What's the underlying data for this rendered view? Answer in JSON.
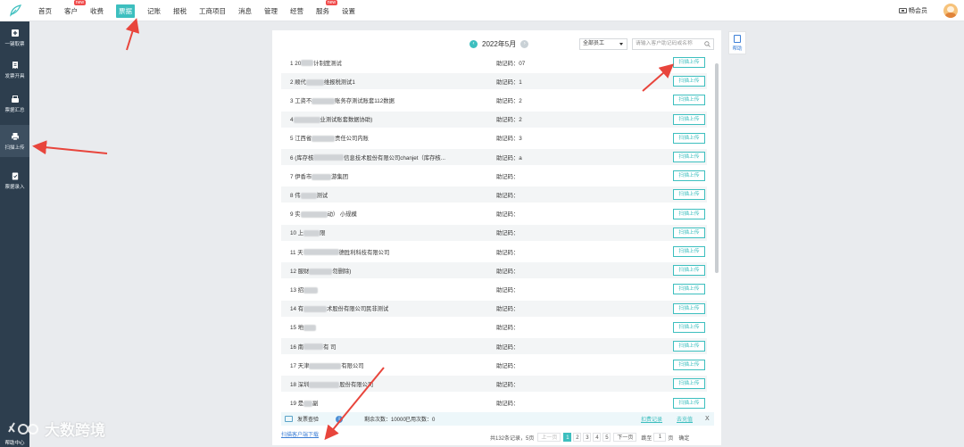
{
  "nav": {
    "items": [
      {
        "label": "首页"
      },
      {
        "label": "客户",
        "badge": "new"
      },
      {
        "label": "收费"
      },
      {
        "label": "票据",
        "active": true
      },
      {
        "label": "记账"
      },
      {
        "label": "报税"
      },
      {
        "label": "工商项目"
      },
      {
        "label": "消息"
      },
      {
        "label": "管理"
      },
      {
        "label": "经营"
      },
      {
        "label": "服务",
        "badge": "new"
      },
      {
        "label": "设置"
      }
    ],
    "member_label": "畅会员"
  },
  "sidebar": {
    "items": [
      {
        "label": "一键取票",
        "icon": "plus-box-icon"
      },
      {
        "label": "发票开具",
        "icon": "receipt-icon"
      },
      {
        "label": "票据汇总",
        "icon": "stack-icon"
      },
      {
        "label": "扫描上传",
        "icon": "printer-icon",
        "active": true
      },
      {
        "label": "票据录入",
        "icon": "clipboard-icon"
      }
    ],
    "help_label": "帮助中心"
  },
  "header": {
    "month": "2022年5月",
    "prev_icon": "chevron-left-icon",
    "next_icon": "chevron-right-icon",
    "staff_select": "全部员工",
    "search_placeholder": "请输入客户助记码或名称"
  },
  "rows": [
    {
      "prefix": "1 20",
      "suffix": "计制度测试",
      "code": "助记码：07",
      "btn": "扫描上传"
    },
    {
      "prefix": "2 顺代",
      "suffix": "维报税测试1",
      "code": "助记码：1",
      "btn": "扫描上传"
    },
    {
      "prefix": "3 工资不",
      "suffix": "账务存测试账套112数据",
      "code": "助记码：2",
      "btn": "扫描上传"
    },
    {
      "prefix": "4",
      "suffix": "业测试账套数据协助)",
      "code": "助记码：2",
      "btn": "扫描上传"
    },
    {
      "prefix": "5 江西省",
      "suffix": "责任公司内账",
      "code": "助记码：3",
      "btn": "扫描上传"
    },
    {
      "prefix": "6 (库存核",
      "suffix": "信息技术股份有限公司chanjet（库存核...",
      "code": "助记码：a",
      "btn": "扫描上传"
    },
    {
      "prefix": "7 伊香市",
      "suffix": "游集团",
      "code": "助记码：",
      "btn": "扫描上传"
    },
    {
      "prefix": "8 伟",
      "suffix": "测试",
      "code": "助记码：",
      "btn": "扫描上传"
    },
    {
      "prefix": "9 实",
      "suffix": "动） 小规模",
      "code": "助记码：",
      "btn": "扫描上传"
    },
    {
      "prefix": "10 上",
      "suffix": "限",
      "code": "助记码：",
      "btn": "扫描上传"
    },
    {
      "prefix": "11 天",
      "suffix": "德胜利科技有限公司",
      "code": "助记码：",
      "btn": "扫描上传"
    },
    {
      "prefix": "12 服财",
      "suffix": "勿删除)",
      "code": "助记码：",
      "btn": "扫描上传"
    },
    {
      "prefix": "13 招",
      "suffix": "",
      "code": "助记码：",
      "btn": "扫描上传"
    },
    {
      "prefix": "14 有",
      "suffix": "术股份有限公司民非测试",
      "code": "助记码：",
      "btn": "扫描上传"
    },
    {
      "prefix": "15 地",
      "suffix": "",
      "code": "助记码：",
      "btn": "扫描上传"
    },
    {
      "prefix": "16 南",
      "suffix": "有 司",
      "code": "助记码：",
      "btn": "扫描上传"
    },
    {
      "prefix": "17 天津",
      "suffix": "有限公司",
      "code": "助记码：",
      "btn": "扫描上传"
    },
    {
      "prefix": "18 深圳",
      "suffix": "股份有限公司",
      "code": "助记码：",
      "btn": "扫描上传"
    },
    {
      "prefix": "19 是",
      "suffix": "副",
      "code": "助记码：",
      "btn": "扫描上传"
    }
  ],
  "footer": {
    "invoice_check": "发票查验",
    "remaining": "剩余次数：10000",
    "used": "已用次数：0",
    "records_link": "扣费记录",
    "recharge_link": "去充值",
    "close": "X"
  },
  "download_link": "扫描客户端下载",
  "pagination": {
    "total": "共132条记录，5页",
    "prev": "上一页",
    "pages": [
      "1",
      "2",
      "3",
      "4",
      "5"
    ],
    "next": "下一页",
    "goto": "跳至",
    "goto_value": "1",
    "page_unit": "页",
    "confirm": "确定"
  },
  "help_button": "帮助",
  "watermark": "大数跨境",
  "colors": {
    "accent": "#3dbfbf",
    "sidebar": "#2d3e4e",
    "arrow": "#e8453c"
  }
}
